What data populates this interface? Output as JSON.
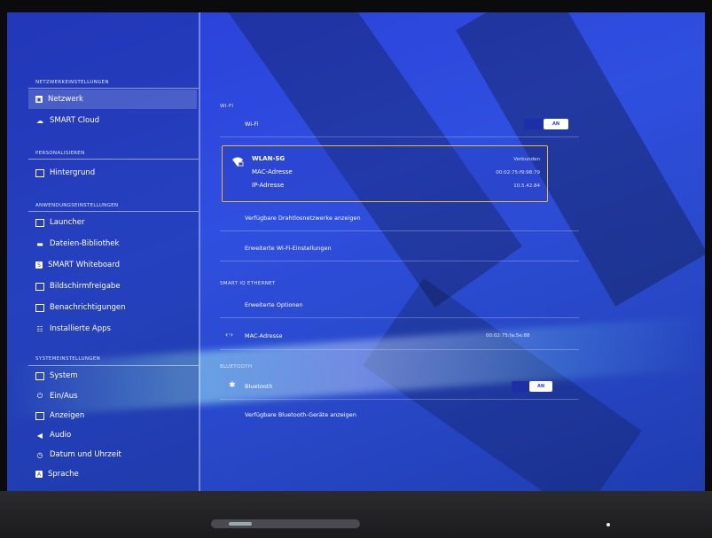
{
  "colors": {
    "accent": "#f2b92a",
    "screen_blue": "#2a3fd8",
    "toggle_on": "#1c2fa8"
  },
  "sidebar": {
    "sections": [
      {
        "heading": "NETZWERKEINSTELLUNGEN",
        "items": [
          {
            "label": "Netzwerk",
            "icon": "network-icon",
            "active": true
          },
          {
            "label": "SMART Cloud",
            "icon": "cloud-icon"
          }
        ]
      },
      {
        "heading": "PERSONALISIEREN",
        "items": [
          {
            "label": "Hintergrund",
            "icon": "image-icon"
          }
        ]
      },
      {
        "heading": "ANWENDUNGSEINSTELLUNGEN",
        "items": [
          {
            "label": "Launcher",
            "icon": "launcher-icon"
          },
          {
            "label": "Dateien-Bibliothek",
            "icon": "folder-icon"
          },
          {
            "label": "SMART Whiteboard",
            "icon": "whiteboard-icon"
          },
          {
            "label": "Bildschirmfreigabe",
            "icon": "screen-share-icon"
          },
          {
            "label": "Benachrichtigungen",
            "icon": "notification-icon"
          },
          {
            "label": "Installierte Apps",
            "icon": "apps-icon"
          }
        ]
      },
      {
        "heading": "SYSTEMEINSTELLUNGEN",
        "items": [
          {
            "label": "System",
            "icon": "system-icon"
          },
          {
            "label": "Ein/Aus",
            "icon": "power-icon"
          },
          {
            "label": "Anzeigen",
            "icon": "display-icon"
          },
          {
            "label": "Audio",
            "icon": "audio-icon"
          },
          {
            "label": "Datum und Uhrzeit",
            "icon": "clock-icon"
          },
          {
            "label": "Sprache",
            "icon": "language-icon"
          }
        ]
      }
    ]
  },
  "main": {
    "wifi": {
      "heading": "WI-FI",
      "toggle_label": "Wi-Fi",
      "toggle_state": "AN",
      "network": {
        "name": "WLAN-SG",
        "status": "Verbunden",
        "mac_label": "MAC-Adresse",
        "mac_value": "00:02:75:f9:98:79",
        "ip_label": "IP-Adresse",
        "ip_value": "10.5.42.84"
      },
      "available_label": "Verfügbare Drahtlosnetzwerke anzeigen",
      "advanced_label": "Erweiterte Wi-Fi-Einstellungen"
    },
    "ethernet": {
      "heading": "SMART IQ ETHERNET",
      "advanced_label": "Erweiterte Optionen",
      "mac_label": "MAC-Adresse",
      "mac_value": "00:02:75:fa:5e:88"
    },
    "bluetooth": {
      "heading": "BLUETOOTH",
      "toggle_label": "Bluetooth",
      "toggle_state": "AN",
      "available_label": "Verfügbare Bluetooth-Geräte anzeigen"
    }
  }
}
